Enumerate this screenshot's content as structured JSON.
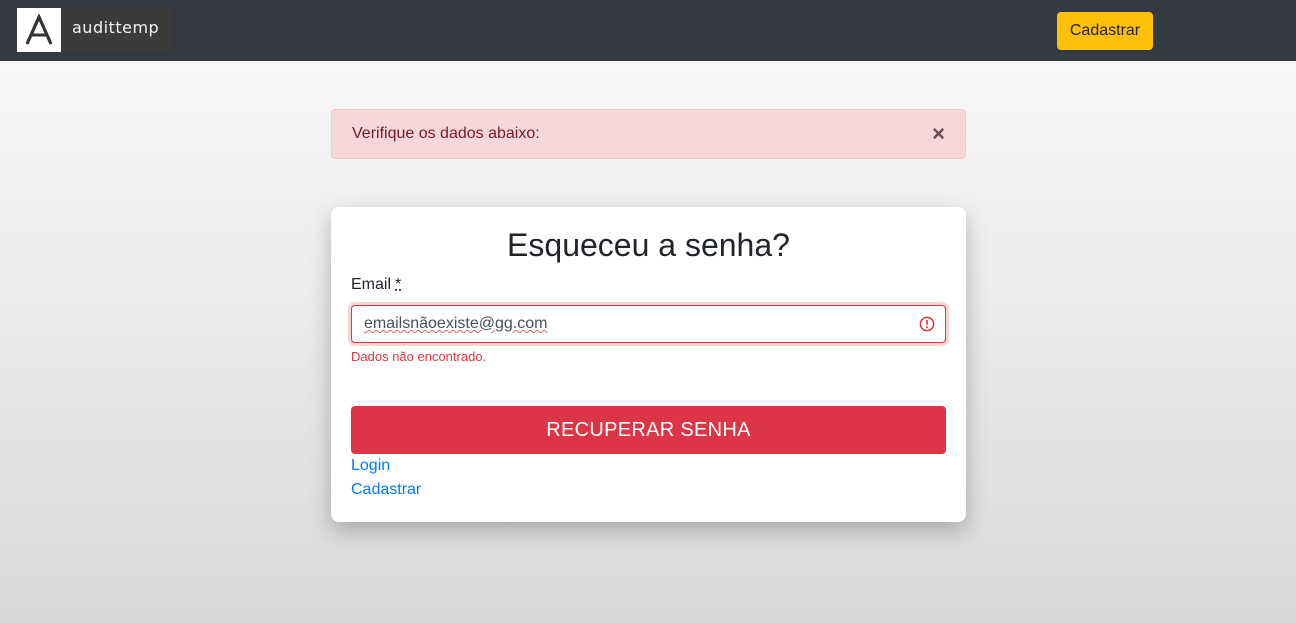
{
  "navbar": {
    "brand_name": "audittemp",
    "register_button": "Cadastrar"
  },
  "alert": {
    "message": "Verifique os dados abaixo:",
    "close": "×"
  },
  "form": {
    "title": "Esqueceu a senha?",
    "email_label": "Email",
    "required_mark": "*",
    "email_value": "emailsnãoexiste@gg.com",
    "error_message": "Dados não encontrado.",
    "submit_label": "RECUPERAR SENHA",
    "login_link": "Login",
    "register_link": "Cadastrar"
  },
  "colors": {
    "navbar": "#343a40",
    "warning": "#ffc107",
    "danger": "#dc3545",
    "link": "#007bff",
    "alert_bg": "#f8d7da"
  },
  "icons": {
    "logo": "logo-a-icon",
    "close": "close-icon",
    "error": "error-circle-icon"
  }
}
